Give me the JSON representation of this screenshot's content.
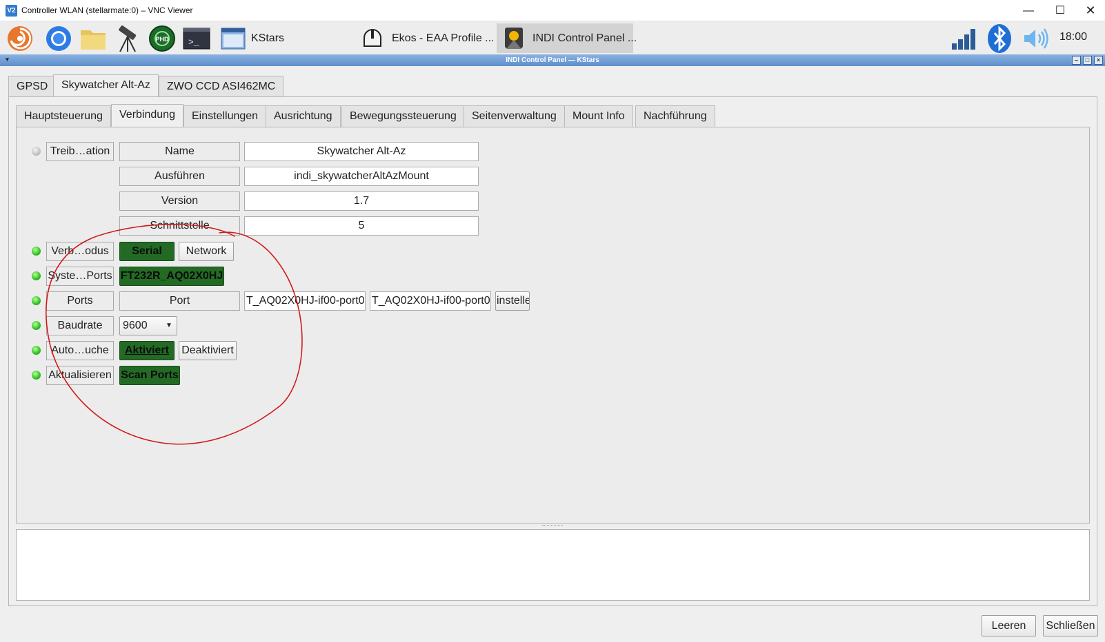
{
  "vnc": {
    "title": "Controller WLAN (stellarmate:0) – VNC Viewer",
    "logo_text": "V2"
  },
  "taskbar": {
    "tasks": [
      {
        "label": "KStars"
      },
      {
        "label": "Ekos - EAA Profile ..."
      },
      {
        "label": "INDI Control Panel ..."
      }
    ],
    "clock": "18:00",
    "phd_text": "PHD",
    "terminal_text": ">_"
  },
  "panel": {
    "title": "INDI Control Panel — KStars",
    "device_tabs": [
      "GPSD",
      "Skywatcher Alt-Az",
      "ZWO CCD ASI462MC"
    ],
    "group_tabs": [
      "Hauptsteuerung",
      "Verbindung",
      "Einstellungen",
      "Ausrichtung",
      "Bewegungssteuerung",
      "Seitenverwaltung",
      "Mount Info",
      "Nachführung"
    ],
    "active_device_tab": "Skywatcher Alt-Az",
    "active_group_tab": "Verbindung"
  },
  "properties": {
    "driver_info": {
      "label": "Treib…ation",
      "rows": [
        {
          "name": "Name",
          "value": "Skywatcher Alt-Az"
        },
        {
          "name": "Ausführen",
          "value": "indi_skywatcherAltAzMount"
        },
        {
          "name": "Version",
          "value": "1.7"
        },
        {
          "name": "Schnittstelle",
          "value": "5"
        }
      ]
    },
    "connection_mode": {
      "label": "Verb…odus",
      "options": [
        "Serial",
        "Network"
      ],
      "selected": "Serial"
    },
    "system_ports": {
      "label": "Syste…Ports",
      "value": "FT232R_AQ02X0HJ"
    },
    "ports": {
      "label": "Ports",
      "name": "Port",
      "current": "T_AQ02X0HJ-if00-port0",
      "new": "T_AQ02X0HJ-if00-port0",
      "set_label": "instelle"
    },
    "baud_rate": {
      "label": "Baudrate",
      "value": "9600"
    },
    "auto_search": {
      "label": "Auto…uche",
      "options": [
        "Aktiviert",
        "Deaktiviert"
      ],
      "selected": "Aktiviert"
    },
    "refresh": {
      "label": "Aktualisieren",
      "button": "Scan Ports"
    }
  },
  "footer": {
    "clear_label": "Leeren",
    "close_label": "Schließen"
  },
  "colors": {
    "accent_green": "#236b25",
    "annotation_red": "#d11a1a",
    "titlebar_blue": "#6f9bd3"
  }
}
